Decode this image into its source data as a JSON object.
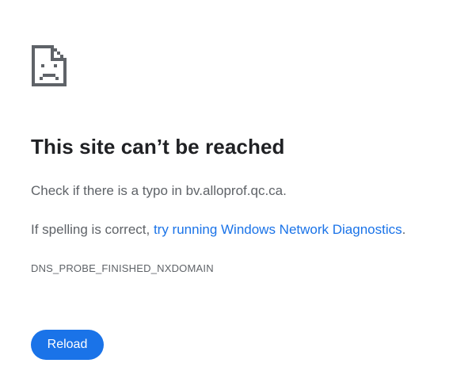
{
  "error_page": {
    "icon": "sad-page-icon",
    "title": "This site can’t be reached",
    "message_prefix": "Check if there is a typo in ",
    "hostname": "bv.alloprof.qc.ca",
    "message_suffix": ".",
    "suggestion_prefix": "If spelling is correct, ",
    "diagnostics_link": "try running Windows Network Diagnostics",
    "suggestion_suffix": ".",
    "error_code": "DNS_PROBE_FINISHED_NXDOMAIN",
    "reload_label": "Reload"
  },
  "colors": {
    "title": "#202124",
    "body_text": "#5f6368",
    "link": "#1a73e8",
    "button_bg": "#1a73e8",
    "button_text": "#ffffff",
    "icon": "#5f6368"
  }
}
